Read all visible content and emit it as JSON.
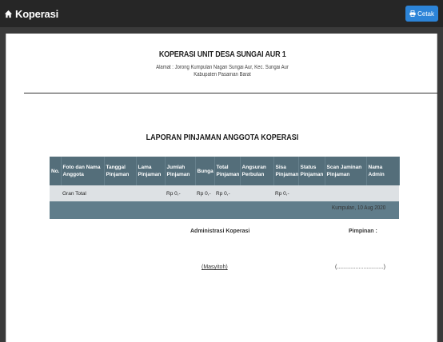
{
  "app": {
    "title": "Koperasi",
    "print_label": "Cetak"
  },
  "header": {
    "org_name": "KOPERASI UNIT DESA SUNGAI AUR 1",
    "address_line1": "Alamat : Jorong Kumpulan Nagari Sungai Aur, Kec. Sungai Aur",
    "address_line2": "Kabupaten Pasaman Barat"
  },
  "report": {
    "title": "LAPORAN PINJAMAN ANGGOTA KOPERASI",
    "columns": [
      [
        "No."
      ],
      [
        "Foto dan Nama",
        "Anggota"
      ],
      [
        "Tanggal",
        "Pinjaman"
      ],
      [
        "Lama",
        "Pinjaman"
      ],
      [
        "Jumlah",
        "Pinjaman"
      ],
      [
        "Bunga"
      ],
      [
        "Total",
        "Pinjaman"
      ],
      [
        "Angsuran",
        "Perbulan"
      ],
      [
        "Sisa",
        "Pinjaman"
      ],
      [
        "Status",
        "Pinjaman"
      ],
      [
        "Scan Jaminan",
        "Pinjaman"
      ],
      [
        "Nama",
        "Admin"
      ]
    ],
    "total_row": [
      "",
      "Gran Total",
      "",
      "",
      "Rp 0,-",
      "Rp 0,-",
      "Rp 0,-",
      "",
      "Rp 0,-",
      "",
      "",
      ""
    ]
  },
  "signature": {
    "date": "Kumpulan, 10 Aug 2020",
    "left_title": "Administrasi Koperasi",
    "right_title": "Pimpinan :",
    "left_name": "(Masyitoh)",
    "right_name": "(..............................)"
  },
  "colors": {
    "topbar": "#262626",
    "accent": "#2c84d8",
    "table_header": "#546e7a"
  },
  "icons": {
    "brand": "home-icon",
    "print": "print-icon"
  }
}
